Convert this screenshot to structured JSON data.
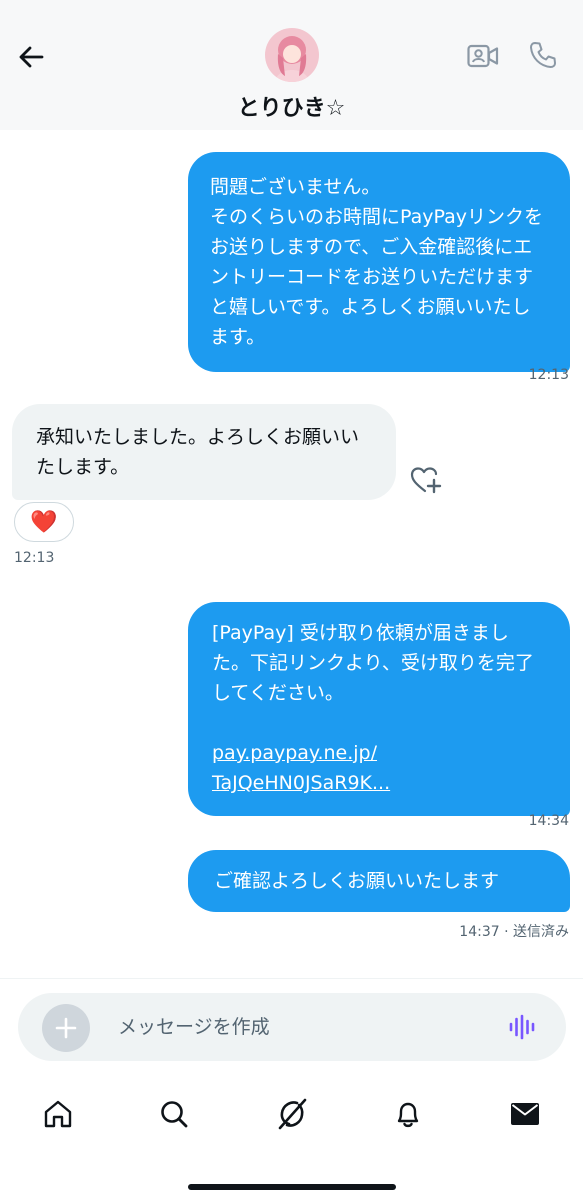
{
  "header": {
    "contact_name": "とりひき☆"
  },
  "messages": [
    {
      "direction": "outgoing",
      "text": "問題ございません。\nそのくらいのお時間にPayPayリンクをお送りしますので、ご入金確認後にエントリーコードをお送りいただけますと嬉しいです。よろしくお願いいたします。",
      "time": "12:13"
    },
    {
      "direction": "incoming",
      "text": "承知いたしました。よろしくお願いいたします。",
      "reaction": "❤️",
      "time": "12:13"
    },
    {
      "direction": "outgoing",
      "text": "[PayPay] 受け取り依頼が届きました。下記リンクより、受け取りを完了してください。",
      "link_line1": "pay.paypay.ne.jp/",
      "link_line2": "TaJQeHN0JSaR9K...",
      "time": "14:34"
    },
    {
      "direction": "outgoing",
      "text": "ご確認よろしくお願いいたします",
      "time": "14:37",
      "status": "14:37 · 送信済み"
    }
  ],
  "composer": {
    "placeholder": "メッセージを作成"
  },
  "colors": {
    "accent": "#1d9bf0",
    "incoming_bubble": "#eff3f4",
    "voice_icon": "#7856ff",
    "heart": "#e0245e"
  },
  "icons": {
    "back": "arrow-left-icon",
    "video": "video-camera-icon",
    "call": "phone-icon",
    "react": "heart-plus-icon",
    "add": "plus-icon",
    "voice": "waveform-icon",
    "tabs": [
      "home-icon",
      "search-icon",
      "grok-icon",
      "bell-icon",
      "mail-icon"
    ]
  }
}
